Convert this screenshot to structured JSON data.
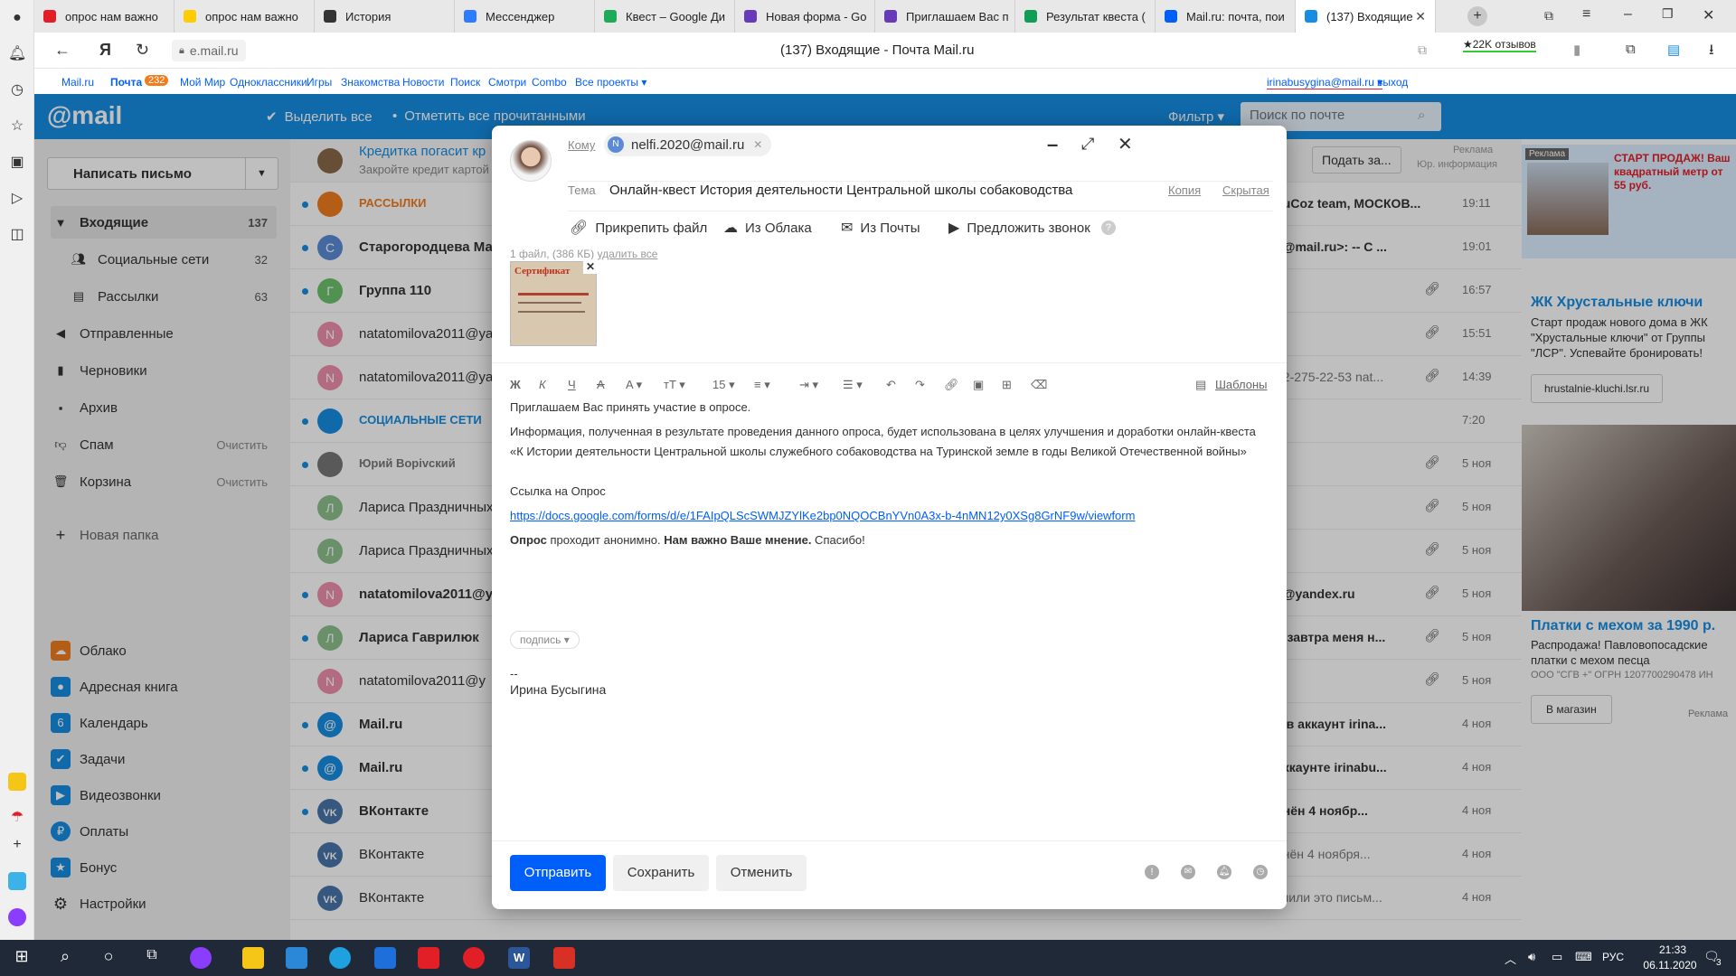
{
  "browser": {
    "tabs": [
      {
        "title": "опрос нам важно",
        "fav": "#e21f26"
      },
      {
        "title": "опрос нам важно",
        "fav": "#ffcc00"
      },
      {
        "title": "История",
        "fav": "#333333"
      },
      {
        "title": "Мессенджер",
        "fav": "#2b7cff"
      },
      {
        "title": "Квест – Google Ди",
        "fav": "#1faa59"
      },
      {
        "title": "Новая форма - Go",
        "fav": "#673ab7"
      },
      {
        "title": "Приглашаем Вас п",
        "fav": "#673ab7"
      },
      {
        "title": "Результат квеста (",
        "fav": "#0f9d58"
      },
      {
        "title": "Mail.ru: почта, пои",
        "fav": "#005ff9"
      },
      {
        "title": "(137) Входящие",
        "fav": "#168de2"
      }
    ],
    "address": "e.mail.ru",
    "page_title": "(137) Входящие - Почта Mail.ru",
    "reviews": "★22K отзывов"
  },
  "toplinks": {
    "items": [
      "Mail.ru",
      "Почта",
      "Мой Мир",
      "Одноклассники",
      "Игры",
      "Знакомства",
      "Новости",
      "Поиск",
      "Смотри",
      "Combo",
      "Все проекты ▾"
    ],
    "pochta_badge": "232",
    "user": "irinabusygina@mail.ru ▾",
    "logout": "выход"
  },
  "header": {
    "logo": "@mail",
    "select_all": "Выделить все",
    "mark_read": "Отметить все прочитанными",
    "filter": "Фильтр ▾",
    "search_placeholder": "Поиск по почте"
  },
  "sidebar": {
    "compose": "Написать письмо",
    "folders": [
      {
        "label": "Входящие",
        "count": "137",
        "icon": "inbox"
      },
      {
        "label": "Социальные сети",
        "count": "32",
        "icon": "people"
      },
      {
        "label": "Рассылки",
        "count": "63",
        "icon": "newsletter"
      },
      {
        "label": "Отправленные",
        "count": "",
        "icon": "sent"
      },
      {
        "label": "Черновики",
        "count": "",
        "icon": "draft"
      },
      {
        "label": "Архив",
        "count": "",
        "icon": "archive"
      },
      {
        "label": "Спам",
        "count": "Очистить",
        "icon": "spam"
      },
      {
        "label": "Корзина",
        "count": "Очистить",
        "icon": "trash"
      }
    ],
    "new_folder": "Новая папка",
    "apps": [
      {
        "label": "Облако",
        "color": "#f07c1e"
      },
      {
        "label": "Адресная книга",
        "color": "#168de2"
      },
      {
        "label": "Календарь",
        "color": "#168de2"
      },
      {
        "label": "Задачи",
        "color": "#168de2"
      },
      {
        "label": "Видеозвонки",
        "color": "#168de2"
      },
      {
        "label": "Оплаты",
        "color": "#168de2"
      },
      {
        "label": "Бонус",
        "color": "#168de2"
      },
      {
        "label": "Настройки",
        "color": "#555555"
      }
    ]
  },
  "list": {
    "ad_row": {
      "title": "Кредитка погасит кр",
      "sub": "Закройте кредит картой",
      "btn": "Подать за...",
      "tag": "Реклама",
      "tag2": "Юр. информация"
    },
    "rows": [
      {
        "from": "РАССЫЛКИ",
        "tail": ", uCoz team, МОСКОВ...",
        "time": "19:11",
        "av": "",
        "color": "#f07c1e",
        "bold": true,
        "clip": false
      },
      {
        "from": "Старогородцева Ма",
        "tail": "a@mail.ru>: -- С ...",
        "time": "19:01",
        "av": "С",
        "color": "#5b8bd6",
        "bold": true,
        "clip": false
      },
      {
        "from": "Группа 110",
        "tail": "",
        "time": "16:57",
        "av": "Г",
        "color": "#6cc36c",
        "bold": true,
        "clip": true
      },
      {
        "from": "natatomilova2011@ya",
        "tail": "",
        "time": "15:51",
        "av": "N",
        "color": "#ef8fae",
        "bold": false,
        "clip": true
      },
      {
        "from": "natatomilova2011@ya",
        "tail": "12-275-22-53 nat...",
        "time": "14:39",
        "av": "N",
        "color": "#ef8fae",
        "bold": false,
        "clip": true
      },
      {
        "from": "СОЦИАЛЬНЫЕ СЕТИ",
        "tail": "",
        "time": "7:20",
        "av": "",
        "color": "#168de2",
        "bold": true,
        "clip": false
      },
      {
        "from": "Юрий Ворivский",
        "tail": "",
        "time": "5 ноя",
        "av": "",
        "color": "#777777",
        "bold": true,
        "clip": true
      },
      {
        "from": "Лариса Праздничных",
        "tail": "",
        "time": "5 ноя",
        "av": "Л",
        "color": "#8cc08c",
        "bold": false,
        "clip": true
      },
      {
        "from": "Лариса Праздничных",
        "tail": "",
        "time": "5 ноя",
        "av": "Л",
        "color": "#8cc08c",
        "bold": false,
        "clip": true
      },
      {
        "from": "natatomilova2011@y",
        "tail": "1@yandex.ru",
        "time": "5 ноя",
        "av": "N",
        "color": "#ef8fae",
        "bold": true,
        "clip": true
      },
      {
        "from": "Лариса Гаврилюк",
        "tail": "? завтра меня н...",
        "time": "5 ноя",
        "av": "Л",
        "color": "#8cc08c",
        "bold": true,
        "clip": true
      },
      {
        "from": "natatomilova2011@y",
        "tail": "",
        "time": "5 ноя",
        "av": "N",
        "color": "#ef8fae",
        "bold": false,
        "clip": true
      },
      {
        "from": "Mail.ru",
        "tail": "а в аккаунт irina...",
        "time": "4 ноя",
        "av": "@",
        "color": "#168de2",
        "bold": true,
        "clip": false
      },
      {
        "from": "Mail.ru",
        "tail": "аккаунте irinabu...",
        "time": "4 ноя",
        "av": "@",
        "color": "#168de2",
        "bold": true,
        "clip": false
      },
      {
        "from": "ВКонтакте",
        "tail": "енён 4 ноябр...",
        "time": "4 ноя",
        "av": "vk",
        "color": "#4a76a8",
        "bold": true,
        "clip": false
      },
      {
        "from": "ВКонтакте",
        "tail": "енён 4 ноября...",
        "time": "4 ноя",
        "av": "vk",
        "color": "#4a76a8",
        "bold": false,
        "clip": false
      },
      {
        "from": "ВКонтакте",
        "tail": "учили это письм...",
        "time": "4 ноя",
        "av": "vk",
        "color": "#4a76a8",
        "bold": false,
        "clip": false
      }
    ]
  },
  "ads": {
    "banner_tag": "Реклама",
    "banner_text": "СТАРТ ПРОДАЖ! Ваш квадратный метр от 55 руб.",
    "ad1_title": "ЖК Хрустальные ключи",
    "ad1_text": "Старт продаж нового дома в ЖК \"Хрустальные ключи\" от Группы \"ЛСР\". Успевайте бронировать!",
    "ad1_btn": "hrustalnie-kluchi.lsr.ru",
    "ad2_title": "Платки с мехом за 1990 р.",
    "ad2_text": "Распродажа! Павловопосадские платки с мехом песца",
    "ad2_legal": "ООО \"СГВ +\" ОГРН 1207700290478 ИН",
    "ad2_btn": "В магазин",
    "ad2_tag": "Реклама"
  },
  "compose": {
    "to_label": "Кому",
    "to_chip": "nelfi.2020@mail.ru",
    "to_chip_initial": "N",
    "subject_label": "Тема",
    "subject": "Онлайн-квест История деятельности Центральной школы собаководства",
    "cc": "Копия",
    "bcc": "Скрытая",
    "tools": [
      "Прикрепить файл",
      "Из Облака",
      "Из Почты",
      "Предложить звонок"
    ],
    "files_info": "1 файл, (386 КБ)",
    "delete_all": "удалить все",
    "attachment_title": "Сертификат",
    "font_size": "15",
    "templates": "Шаблоны",
    "body": {
      "p1": "Приглашаем Вас принять участие в опросе.",
      "p2": "Информация, полученная в результате проведения данного опроса, будет использована в целях улучшения и доработки онлайн-квеста «К Истории деятельности Центральной школы служебного собаководства на Туринской земле в годы Великой Отечественной войны»",
      "p3": "Ссылка на Опрос",
      "link": "https://docs.google.com/forms/d/e/1FAIpQLScSWMJZYlKe2bp0NQOCBnYVn0A3x-b-4nMN12y0XSg8GrNF9w/viewform",
      "p4_b1": "Опрос",
      "p4_t1": " проходит анонимно. ",
      "p4_b2": "Нам важно Ваше мнение.",
      "p4_t2": " Спасибо!"
    },
    "signature_btn": "подпись ▾",
    "sig_dash": "--",
    "sig_name": "Ирина Бусыгина",
    "send": "Отправить",
    "save": "Сохранить",
    "cancel": "Отменить"
  },
  "taskbar": {
    "lang": "РУС",
    "time": "21:33",
    "date": "06.11.2020",
    "notif": "3"
  }
}
